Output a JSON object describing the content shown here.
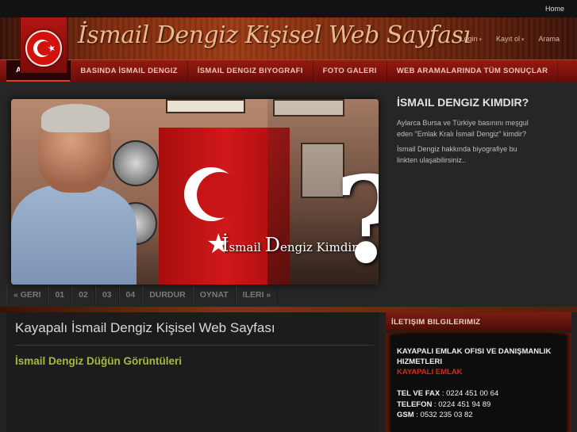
{
  "topbar": {
    "home_label": "Home"
  },
  "header": {
    "site_title": "İsmail Dengiz Kişisel Web Sayfası",
    "login_label": "Login",
    "register_label": "Kayıt ol",
    "search_label": "Arama"
  },
  "nav": {
    "items": [
      {
        "label": "ANA SAYFA"
      },
      {
        "label": "BASINDA İSMAIL DENGIZ"
      },
      {
        "label": "İSMAIL DENGIZ BIYOGRAFI"
      },
      {
        "label": "FOTO GALERI"
      },
      {
        "label": "WEB ARAMALARINDA TÜM SONUÇLAR"
      }
    ]
  },
  "slider": {
    "image_caption_small_1": "smail",
    "image_caption_big_1": "İ",
    "image_caption_small_2": "engiz Kimdir",
    "image_caption_big_2": "D",
    "question_mark": "?",
    "heading": "İSMAIL DENGIZ KIMDIR?",
    "para1": "Aylarca Bursa ve Türkiye basınını meşgul eden \"Emlak Kralı İsmail Dengiz\" kimdir?",
    "para2": "İsmail Dengiz hakkında biyografiye bu linkten ulaşabilirsiniz..",
    "controls": {
      "prev": "« GERI",
      "p1": "01",
      "p2": "02",
      "p3": "03",
      "p4": "04",
      "stop": "DURDUR",
      "play": "OYNAT",
      "next": "ILERI »"
    }
  },
  "main": {
    "title": "Kayapalı İsmail Dengiz Kişisel Web Sayfası",
    "subtitle": "İsmail Dengiz Düğün Görüntüleri"
  },
  "sidebar": {
    "heading": "İLETIŞIM BILGILERIMIZ",
    "company": "KAYAPALI EMLAK OFISI VE DANIŞMANLIK HIZMETLERI",
    "brand": "KAYAPALI EMLAK",
    "tel_fax_label": "TEL VE FAX",
    "tel_fax_value": " : 0224 451 00 64",
    "phone_label": "TELEFON",
    "phone_value": " : 0224 451 94 89",
    "gsm_label": "GSM",
    "gsm_value": " : 0532 235 03 82"
  },
  "colors": {
    "accent_red": "#951a12",
    "brand_red": "#d42a1a",
    "subtitle_green": "#a6b93a"
  }
}
